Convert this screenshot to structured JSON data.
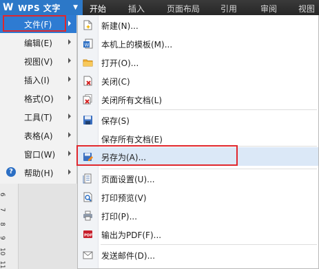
{
  "app_button": {
    "logo": "W",
    "label": "WPS 文字",
    "caret": "▼"
  },
  "ribbon_tabs": [
    "开始",
    "插入",
    "页面布局",
    "引用",
    "审阅",
    "视图"
  ],
  "left_menu": [
    {
      "label": "文件(F)"
    },
    {
      "label": "编辑(E)"
    },
    {
      "label": "视图(V)"
    },
    {
      "label": "插入(I)"
    },
    {
      "label": "格式(O)"
    },
    {
      "label": "工具(T)"
    },
    {
      "label": "表格(A)"
    },
    {
      "label": "窗口(W)"
    },
    {
      "label": "帮助(H)"
    }
  ],
  "help_icon": "?",
  "ruler_numbers": [
    "6",
    "7",
    "8",
    "9",
    "10",
    "11"
  ],
  "file_submenu": [
    {
      "label": "新建(N)...",
      "icon": "new-doc-icon"
    },
    {
      "label": "本机上的模板(M)...",
      "icon": "template-icon"
    },
    {
      "label": "打开(O)...",
      "icon": "open-folder-icon"
    },
    {
      "label": "关闭(C)",
      "icon": "close-doc-icon"
    },
    {
      "label": "关闭所有文档(L)",
      "icon": "close-all-icon"
    },
    {
      "label": "保存(S)",
      "icon": "save-icon"
    },
    {
      "label": "保存所有文档(E)",
      "icon": ""
    },
    {
      "label": "另存为(A)...",
      "icon": "save-as-icon"
    },
    {
      "label": "页面设置(U)...",
      "icon": "page-setup-icon"
    },
    {
      "label": "打印预览(V)",
      "icon": "print-preview-icon"
    },
    {
      "label": "打印(P)...",
      "icon": "printer-icon"
    },
    {
      "label": "输出为PDF(F)...",
      "icon": "pdf-icon"
    },
    {
      "label": "发送邮件(D)...",
      "icon": "mail-icon"
    }
  ],
  "colors": {
    "accent_blue": "#2e7bd2",
    "highlight_red": "#e0262c",
    "ribbon_dark": "#2b2b2b"
  }
}
